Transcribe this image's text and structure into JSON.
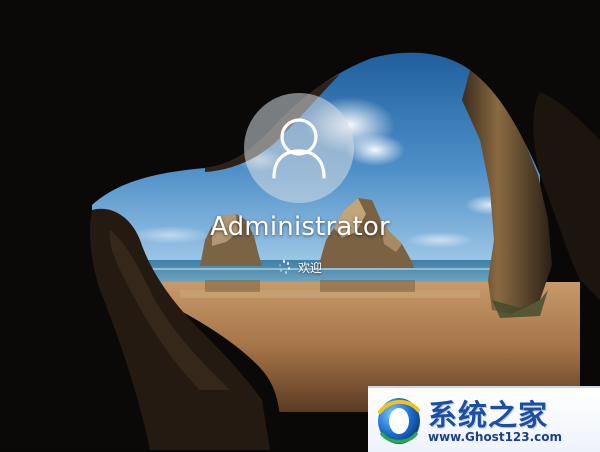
{
  "login": {
    "username": "Administrator",
    "status_text": "欢迎"
  },
  "watermark": {
    "title": "系统之家",
    "url": "www.Ghost123.com"
  },
  "icons": {
    "avatar": "user-silhouette-icon",
    "spinner": "loading-dots-icon",
    "logo": "ghost-logo-icon"
  },
  "colors": {
    "text": "#ffffff",
    "avatar_bg": "#d7dce1",
    "watermark_title": "#1c4fa0"
  }
}
